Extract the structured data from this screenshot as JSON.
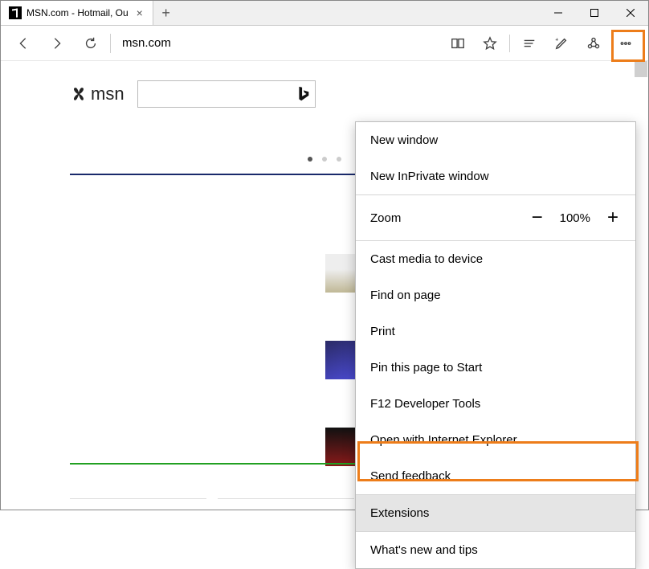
{
  "tab": {
    "title": "MSN.com - Hotmail, Ou",
    "close_glyph": "×"
  },
  "newtab_glyph": "+",
  "address": "msn.com",
  "msn": {
    "brand": "msn"
  },
  "dots_count": 3,
  "menu": {
    "new_window": "New window",
    "new_inprivate": "New InPrivate window",
    "zoom_label": "Zoom",
    "zoom_value": "100%",
    "cast": "Cast media to device",
    "find": "Find on page",
    "print": "Print",
    "pin": "Pin this page to Start",
    "f12": "F12 Developer Tools",
    "open_ie": "Open with Internet Explorer",
    "feedback": "Send feedback",
    "extensions": "Extensions",
    "whatsnew": "What's new and tips"
  }
}
